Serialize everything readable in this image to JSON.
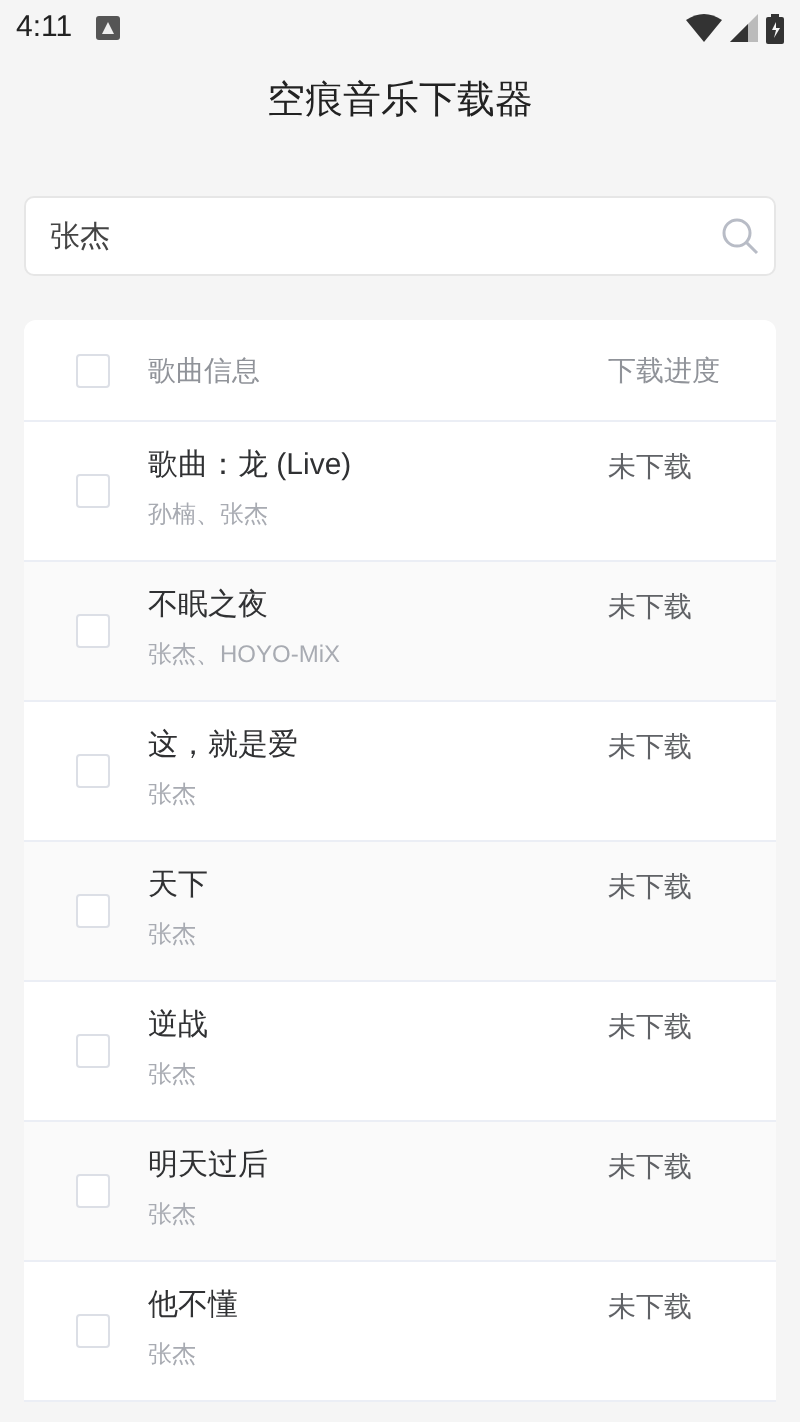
{
  "status_bar": {
    "time": "4:11"
  },
  "header": {
    "title": "空痕音乐下载器"
  },
  "search": {
    "value": "张杰"
  },
  "table": {
    "select_all": {
      "checked": false
    },
    "columns": [
      "歌曲信息",
      "下载进度"
    ],
    "rows": [
      {
        "title": "歌曲：龙 (Live)",
        "artist": "孙楠、张杰",
        "progress": "未下载",
        "checked": false
      },
      {
        "title": "不眠之夜",
        "artist": "张杰、HOYO-MiX",
        "progress": "未下载",
        "checked": false
      },
      {
        "title": "这，就是爱",
        "artist": "张杰",
        "progress": "未下载",
        "checked": false
      },
      {
        "title": "天下",
        "artist": "张杰",
        "progress": "未下载",
        "checked": false
      },
      {
        "title": "逆战",
        "artist": "张杰",
        "progress": "未下载",
        "checked": false
      },
      {
        "title": "明天过后",
        "artist": "张杰",
        "progress": "未下载",
        "checked": false
      },
      {
        "title": "他不懂",
        "artist": "张杰",
        "progress": "未下载",
        "checked": false
      }
    ]
  }
}
